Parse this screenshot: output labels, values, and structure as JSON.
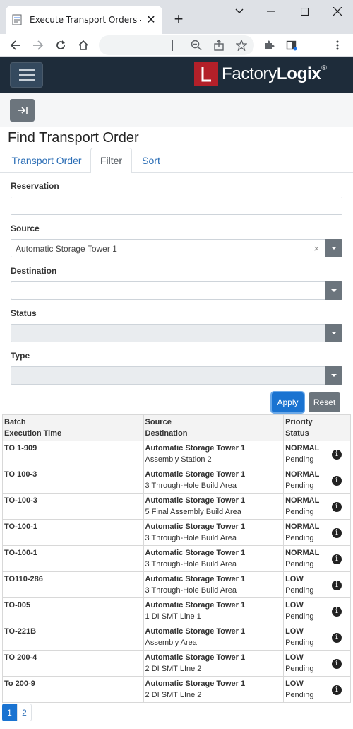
{
  "browser": {
    "tab_title": "Execute Transport Orders - Fa",
    "tab_close": "✕",
    "newtab": "+"
  },
  "app": {
    "logo_mark": "L",
    "logo_word_a": "Factory",
    "logo_word_b": "Logix",
    "logo_reg": "®",
    "page_title": "Find Transport Order",
    "tabs": [
      {
        "label": "Transport Order",
        "active": false
      },
      {
        "label": "Filter",
        "active": true
      },
      {
        "label": "Sort",
        "active": false
      }
    ]
  },
  "filter": {
    "reservation_label": "Reservation",
    "reservation_value": "",
    "source_label": "Source",
    "source_value": "Automatic Storage Tower 1",
    "source_clear": "×",
    "destination_label": "Destination",
    "destination_value": "",
    "status_label": "Status",
    "type_label": "Type",
    "apply_label": "Apply",
    "reset_label": "Reset"
  },
  "table": {
    "headers": {
      "col1a": "Batch",
      "col1b": "Execution Time",
      "col2a": "Source",
      "col2b": "Destination",
      "col3a": "Priority",
      "col3b": "Status"
    },
    "rows": [
      {
        "batch": "TO 1-909",
        "source": "Automatic Storage Tower 1",
        "destination": "Assembly Station 2",
        "priority": "NORMAL",
        "status": "Pending"
      },
      {
        "batch": "TO 100-3",
        "source": "Automatic Storage Tower 1",
        "destination": "3 Through-Hole Build Area",
        "priority": "NORMAL",
        "status": "Pending"
      },
      {
        "batch": "TO-100-3",
        "source": "Automatic Storage Tower 1",
        "destination": "5 Final Assembly Build Area",
        "priority": "NORMAL",
        "status": "Pending"
      },
      {
        "batch": "TO-100-1",
        "source": "Automatic Storage Tower 1",
        "destination": "3 Through-Hole Build Area",
        "priority": "NORMAL",
        "status": "Pending"
      },
      {
        "batch": "TO-100-1",
        "source": "Automatic Storage Tower 1",
        "destination": "3 Through-Hole Build Area",
        "priority": "NORMAL",
        "status": "Pending"
      },
      {
        "batch": "TO110-286",
        "source": "Automatic Storage Tower 1",
        "destination": "3 Through-Hole Build Area",
        "priority": "LOW",
        "status": "Pending"
      },
      {
        "batch": "TO-005",
        "source": "Automatic Storage Tower 1",
        "destination": "1 DI SMT Line 1",
        "priority": "LOW",
        "status": "Pending"
      },
      {
        "batch": "TO-221B",
        "source": "Automatic Storage Tower 1",
        "destination": "Assembly Area",
        "priority": "LOW",
        "status": "Pending"
      },
      {
        "batch": "TO 200-4",
        "source": "Automatic Storage Tower 1",
        "destination": "2 DI SMT LIne 2",
        "priority": "LOW",
        "status": "Pending"
      },
      {
        "batch": "To 200-9",
        "source": "Automatic Storage Tower 1",
        "destination": "2 DI SMT LIne 2",
        "priority": "LOW",
        "status": "Pending"
      }
    ],
    "info_glyph": "i"
  },
  "pager": {
    "pages": [
      "1",
      "2"
    ],
    "current": "1"
  }
}
